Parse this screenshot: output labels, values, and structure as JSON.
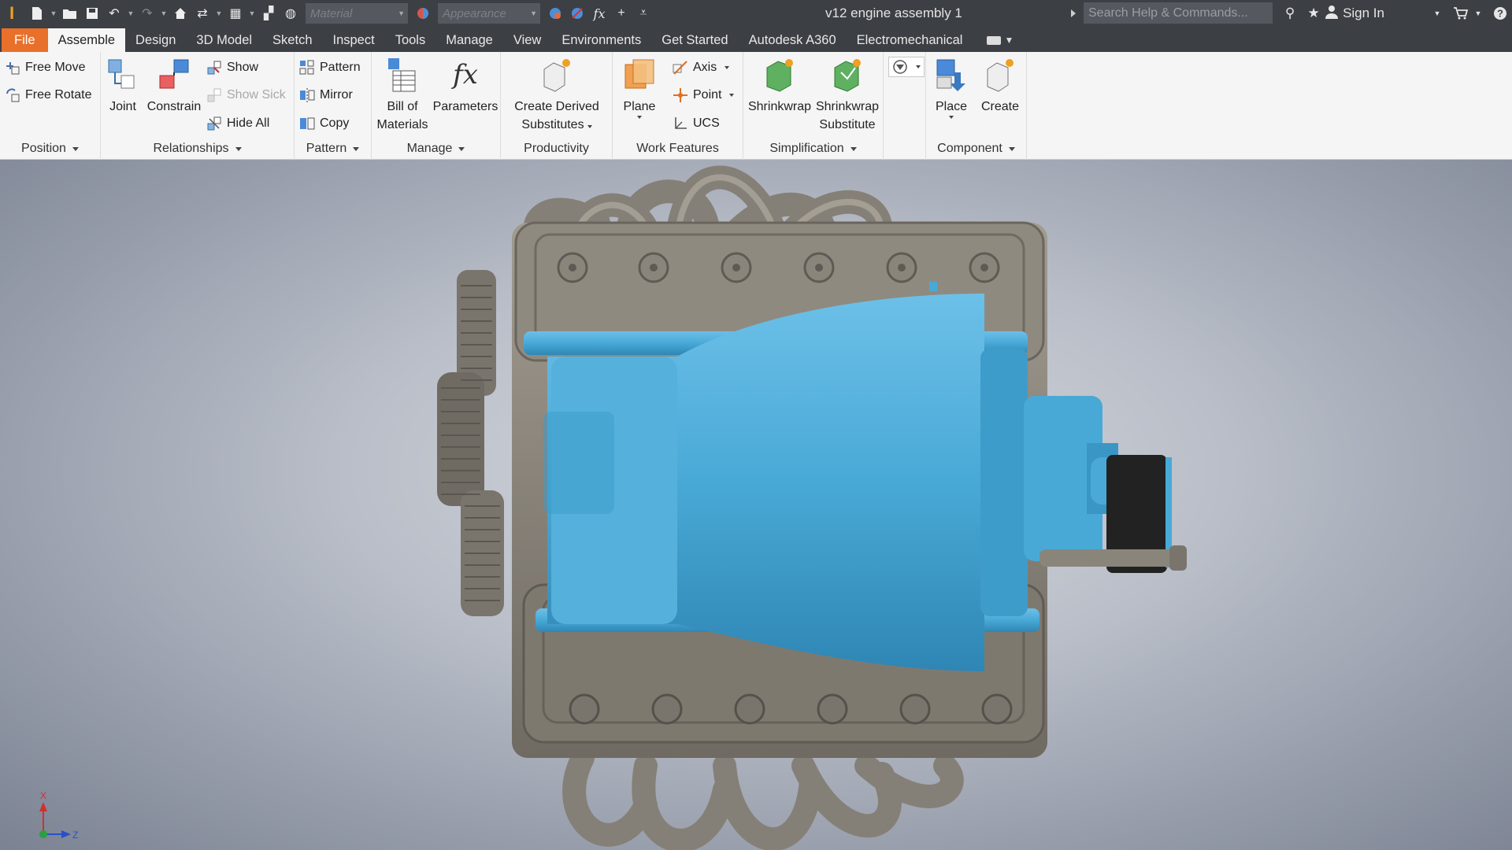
{
  "app": {
    "logo_letter": "I",
    "document_title": "v12 engine assembly 1"
  },
  "quick_access": {
    "material_placeholder": "Material",
    "appearance_placeholder": "Appearance",
    "fx_label": "fx"
  },
  "search": {
    "placeholder": "Search Help & Commands..."
  },
  "account": {
    "sign_in_label": "Sign In"
  },
  "tabs": [
    {
      "label": "File"
    },
    {
      "label": "Assemble"
    },
    {
      "label": "Design"
    },
    {
      "label": "3D Model"
    },
    {
      "label": "Sketch"
    },
    {
      "label": "Inspect"
    },
    {
      "label": "Tools"
    },
    {
      "label": "Manage"
    },
    {
      "label": "View"
    },
    {
      "label": "Environments"
    },
    {
      "label": "Get Started"
    },
    {
      "label": "Autodesk A360"
    },
    {
      "label": "Electromechanical"
    }
  ],
  "ribbon": {
    "position": {
      "title": "Position",
      "free_move": "Free Move",
      "free_rotate": "Free Rotate"
    },
    "relationships": {
      "title": "Relationships",
      "joint": "Joint",
      "constrain": "Constrain",
      "show": "Show",
      "show_sick": "Show Sick",
      "hide_all": "Hide All"
    },
    "pattern": {
      "title": "Pattern",
      "pattern": "Pattern",
      "mirror": "Mirror",
      "copy": "Copy"
    },
    "manage": {
      "title": "Manage",
      "bill_line1": "Bill of",
      "bill_line2": "Materials",
      "parameters": "Parameters"
    },
    "productivity": {
      "title": "Productivity",
      "derived_line1": "Create Derived",
      "derived_line2": "Substitutes"
    },
    "work_features": {
      "title": "Work Features",
      "plane": "Plane",
      "axis": "Axis",
      "point": "Point",
      "ucs": "UCS"
    },
    "simplification": {
      "title": "Simplification",
      "shrinkwrap": "Shrinkwrap",
      "sub_line1": "Shrinkwrap",
      "sub_line2": "Substitute"
    },
    "component": {
      "title": "Component",
      "place": "Place",
      "create": "Create"
    }
  },
  "viewport": {
    "axis_x": "X",
    "axis_z": "Z"
  },
  "colors": {
    "title_bar": "#3c3f44",
    "file_tab": "#e8702a",
    "ribbon_bg": "#f5f5f5",
    "engine_block": "#8a857b",
    "transmission": "#49a9d6"
  }
}
